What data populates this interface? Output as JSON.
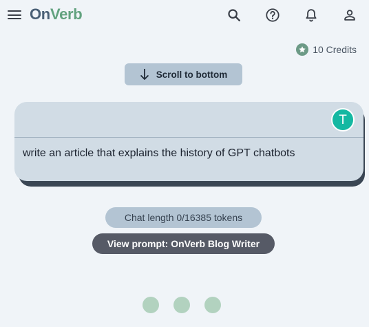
{
  "header": {
    "logo_part1": "On",
    "logo_part2": "Verb",
    "icons": [
      "menu-icon",
      "search-icon",
      "help-icon",
      "bell-icon",
      "account-icon"
    ]
  },
  "credits": {
    "text": "10 Credits",
    "icon": "star-icon"
  },
  "scroll_button": {
    "label": "Scroll to bottom",
    "icon": "arrow-down-icon"
  },
  "message": {
    "avatar_initial": "T",
    "text": "write an article that explains the history of GPT chatbots"
  },
  "chat_length": {
    "label": "Chat length 0/16385 tokens"
  },
  "view_prompt": {
    "label": "View prompt: OnVerb Blog Writer"
  },
  "loading": {
    "dot_count": 3
  },
  "colors": {
    "background": "#f0f4f8",
    "logo_on": "#4a6076",
    "logo_verb": "#62a27f",
    "avatar": "#14b8a2",
    "card": "#d1dce5",
    "card_shadow": "#3a4654",
    "pill_light": "#b3c4d3",
    "pill_dark": "#565a66",
    "loading_dot": "#b2d2bf"
  }
}
